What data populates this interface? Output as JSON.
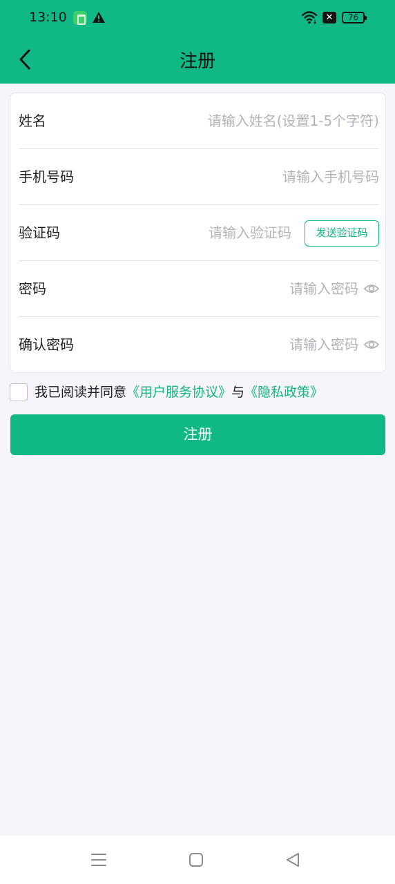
{
  "status_bar": {
    "time": "13:10",
    "icons": [
      "app-badge-icon",
      "alert-icon",
      "wifi-icon",
      "no-sim-icon"
    ],
    "no_sim": "✕",
    "battery": "76"
  },
  "header": {
    "title": "注册",
    "back_icon": "chevron-left-icon",
    "background_color": "#0fb885"
  },
  "form": {
    "name": {
      "label": "姓名",
      "placeholder": "请输入姓名(设置1-5个字符)",
      "value": ""
    },
    "phone": {
      "label": "手机号码",
      "placeholder": "请输入手机号码",
      "value": ""
    },
    "code": {
      "label": "验证码",
      "placeholder": "请输入验证码",
      "value": "",
      "send_button": "发送验证码"
    },
    "password": {
      "label": "密码",
      "placeholder": "请输入密码",
      "value": "",
      "icon": "eye-icon"
    },
    "confirm_password": {
      "label": "确认密码",
      "placeholder": "请输入密码",
      "value": "",
      "icon": "eye-icon"
    }
  },
  "agreement": {
    "checked": false,
    "prefix": "我已阅读并同意",
    "terms_link": "《用户服务协议》",
    "conjunction": "与",
    "privacy_link": "《隐私政策》"
  },
  "submit": {
    "label": "注册"
  },
  "nav_bar": {
    "icons": [
      "menu-icon",
      "home-icon",
      "back-icon"
    ]
  },
  "colors": {
    "accent": "#0fb885",
    "background": "#f7f5f9",
    "placeholder": "#b3b3b8"
  }
}
